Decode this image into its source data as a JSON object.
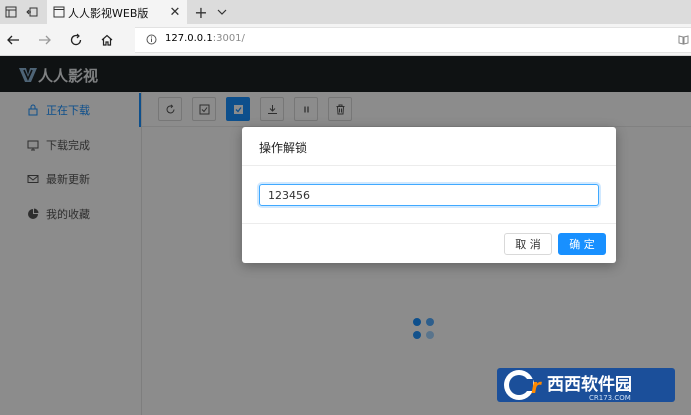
{
  "browser": {
    "tab_title": "人人影视WEB版",
    "url_host": "127.0.0.1",
    "url_rest": ":3001/"
  },
  "app": {
    "logo_text": "人人影视",
    "sidebar": [
      {
        "label": "正在下载",
        "icon": "lock-icon",
        "active": true
      },
      {
        "label": "下载完成",
        "icon": "monitor-icon",
        "active": false
      },
      {
        "label": "最新更新",
        "icon": "mail-icon",
        "active": false
      },
      {
        "label": "我的收藏",
        "icon": "pie-chart-icon",
        "active": false
      }
    ],
    "toolbar_icons": [
      "refresh-icon",
      "checkbox-icon",
      "checkbox-checked-icon",
      "download-icon",
      "pause-icon",
      "trash-icon"
    ]
  },
  "modal": {
    "title": "操作解锁",
    "input_value": "123456",
    "cancel_label": "取 消",
    "ok_label": "确 定"
  },
  "watermark": {
    "text": "西西软件园",
    "sub": "CR173.COM"
  },
  "colors": {
    "accent": "#1890ff",
    "header_bg": "#1d2124",
    "watermark_bg": "#1b4f9a"
  }
}
